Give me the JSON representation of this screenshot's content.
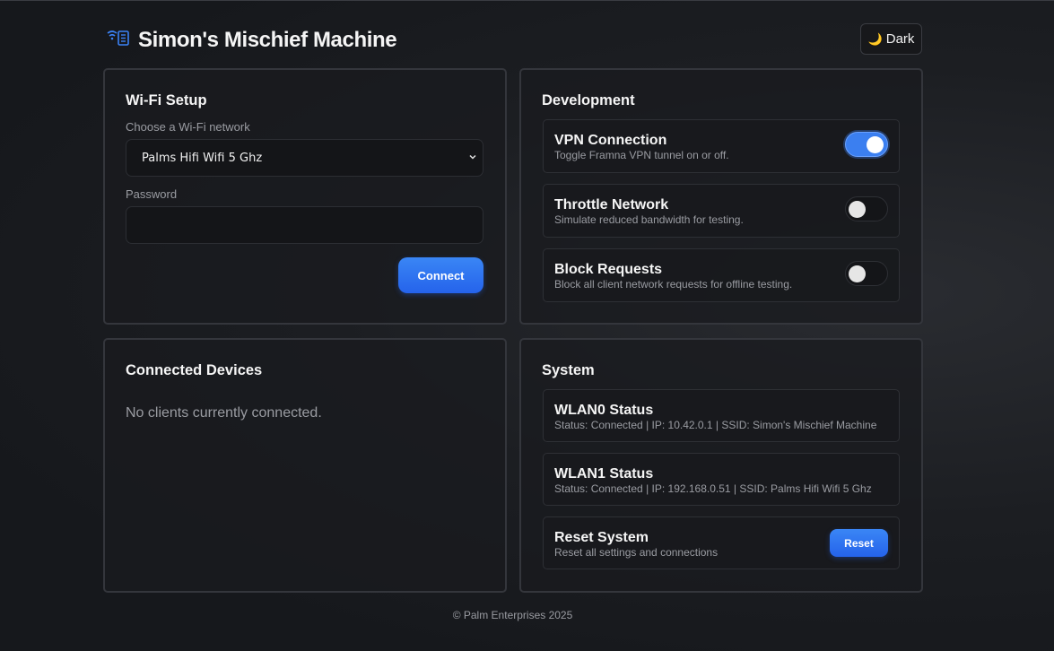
{
  "header": {
    "title": "Simon's Mischief Machine",
    "logo_icon": "wifi-router-icon",
    "theme_toggle_label": "Dark",
    "theme_toggle_icon": "moon-icon"
  },
  "wifi_setup": {
    "title": "Wi-Fi Setup",
    "network_label": "Choose a Wi-Fi network",
    "selected_network": "Palms Hifi Wifi 5 Ghz",
    "password_label": "Password",
    "password_value": "",
    "connect_label": "Connect"
  },
  "development": {
    "title": "Development",
    "items": [
      {
        "title": "VPN Connection",
        "description": "Toggle Framna VPN tunnel on or off.",
        "enabled": true
      },
      {
        "title": "Throttle Network",
        "description": "Simulate reduced bandwidth for testing.",
        "enabled": false
      },
      {
        "title": "Block Requests",
        "description": "Block all client network requests for offline testing.",
        "enabled": false
      }
    ]
  },
  "connected_devices": {
    "title": "Connected Devices",
    "empty_message": "No clients currently connected."
  },
  "system": {
    "title": "System",
    "items": [
      {
        "title": "WLAN0 Status",
        "description": "Status: Connected | IP: 10.42.0.1 | SSID: Simon's Mischief Machine"
      },
      {
        "title": "WLAN1 Status",
        "description": "Status: Connected | IP: 192.168.0.51 | SSID: Palms Hifi Wifi 5 Ghz"
      },
      {
        "title": "Reset System",
        "description": "Reset all settings and connections",
        "button_label": "Reset"
      }
    ]
  },
  "footer": {
    "text": "© Palm Enterprises 2025"
  },
  "colors": {
    "accent": "#2563eb",
    "background": "#1c1e22",
    "card_border": "#34363c"
  }
}
